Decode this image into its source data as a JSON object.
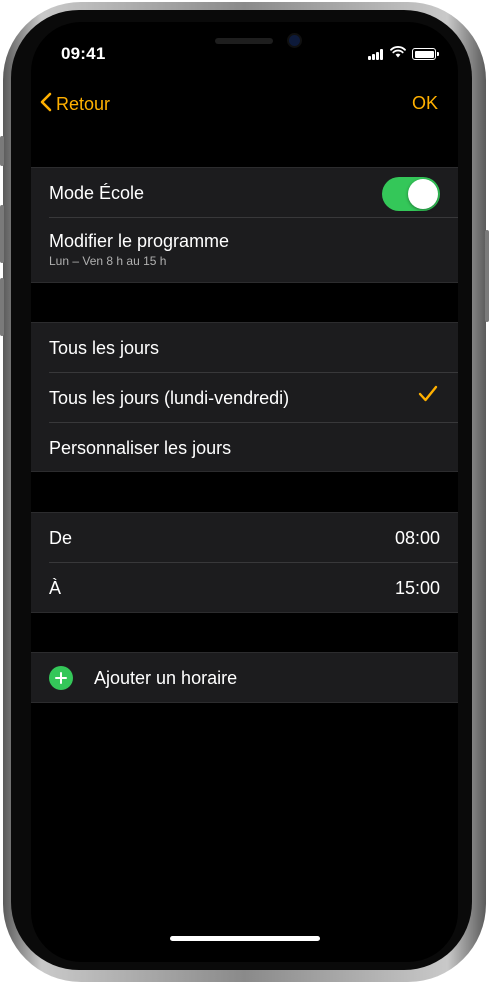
{
  "status": {
    "time": "09:41"
  },
  "nav": {
    "back_label": "Retour",
    "ok_label": "OK"
  },
  "school_mode": {
    "label": "Mode École",
    "enabled": true,
    "schedule_label": "Modifier le programme",
    "schedule_summary": "Lun – Ven 8 h au 15 h"
  },
  "days": {
    "options": [
      {
        "label": "Tous les jours",
        "selected": false
      },
      {
        "label": "Tous les jours (lundi-vendredi)",
        "selected": true
      },
      {
        "label": "Personnaliser les jours",
        "selected": false
      }
    ]
  },
  "time_range": {
    "from_label": "De",
    "from_value": "08:00",
    "to_label": "À",
    "to_value": "15:00"
  },
  "add_schedule": {
    "label": "Ajouter un horaire"
  },
  "colors": {
    "accent": "#ffb000",
    "toggle_on": "#34c759",
    "add_icon": "#34c759",
    "background": "#000000",
    "row_background": "#1c1c1e"
  },
  "icons": [
    "back-chevron-icon",
    "checkmark-icon",
    "add-icon",
    "signal-icon",
    "wifi-icon",
    "battery-icon"
  ]
}
